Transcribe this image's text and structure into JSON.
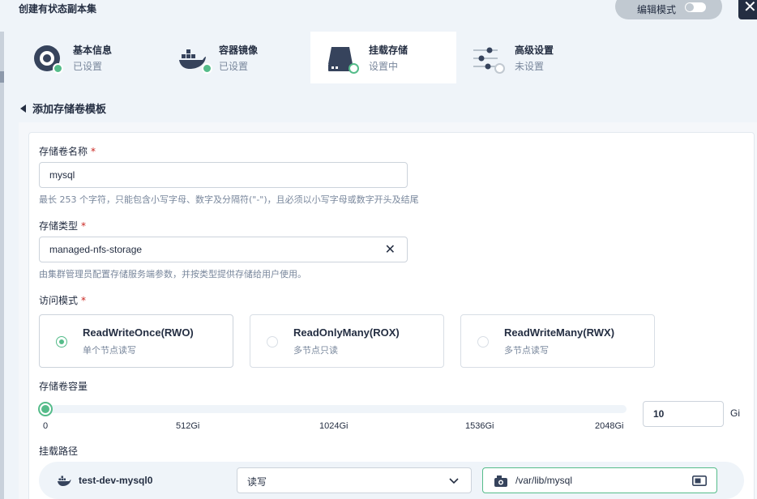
{
  "header": {
    "title": "创建有状态副本集",
    "edit_mode_label": "编辑模式",
    "close_glyph": "✕"
  },
  "steps": [
    {
      "name": "基本信息",
      "status": "已设置",
      "icon": "settings-disk-icon",
      "state": "done"
    },
    {
      "name": "容器镜像",
      "status": "已设置",
      "icon": "docker-whale-icon",
      "state": "done"
    },
    {
      "name": "挂载存储",
      "status": "设置中",
      "icon": "storage-drive-icon",
      "state": "current"
    },
    {
      "name": "高级设置",
      "status": "未设置",
      "icon": "sliders-icon",
      "state": "todo"
    }
  ],
  "back_label": "添加存储卷模板",
  "form": {
    "name_label": "存储卷名称",
    "name_value": "mysql",
    "name_hint": "最长 253 个字符，只能包含小写字母、数字及分隔符(\"-\")，且必须以小写字母或数字开头及结尾",
    "class_label": "存储类型",
    "class_value": "managed-nfs-storage",
    "class_hint": "由集群管理员配置存储服务端参数，并按类型提供存储给用户使用。",
    "access_label": "访问模式",
    "access_modes": [
      {
        "title": "ReadWriteOnce(RWO)",
        "desc": "单个节点读写",
        "selected": true
      },
      {
        "title": "ReadOnlyMany(ROX)",
        "desc": "多节点只读",
        "selected": false
      },
      {
        "title": "ReadWriteMany(RWX)",
        "desc": "多节点读写",
        "selected": false
      }
    ],
    "capacity_label": "存储卷容量",
    "capacity_ticks": [
      "0",
      "512Gi",
      "1024Gi",
      "1536Gi",
      "2048Gi"
    ],
    "capacity_value": "10",
    "capacity_unit": "Gi",
    "capacity_slider_fraction": 0.005,
    "mount_label": "挂载路径",
    "mount": {
      "container": "test-dev-mysql0",
      "mode": "读写",
      "path": "/var/lib/mysql"
    },
    "required_mark": "*"
  },
  "colors": {
    "accent": "#55bc8a",
    "dark": "#242e42",
    "muted": "#79879c"
  }
}
